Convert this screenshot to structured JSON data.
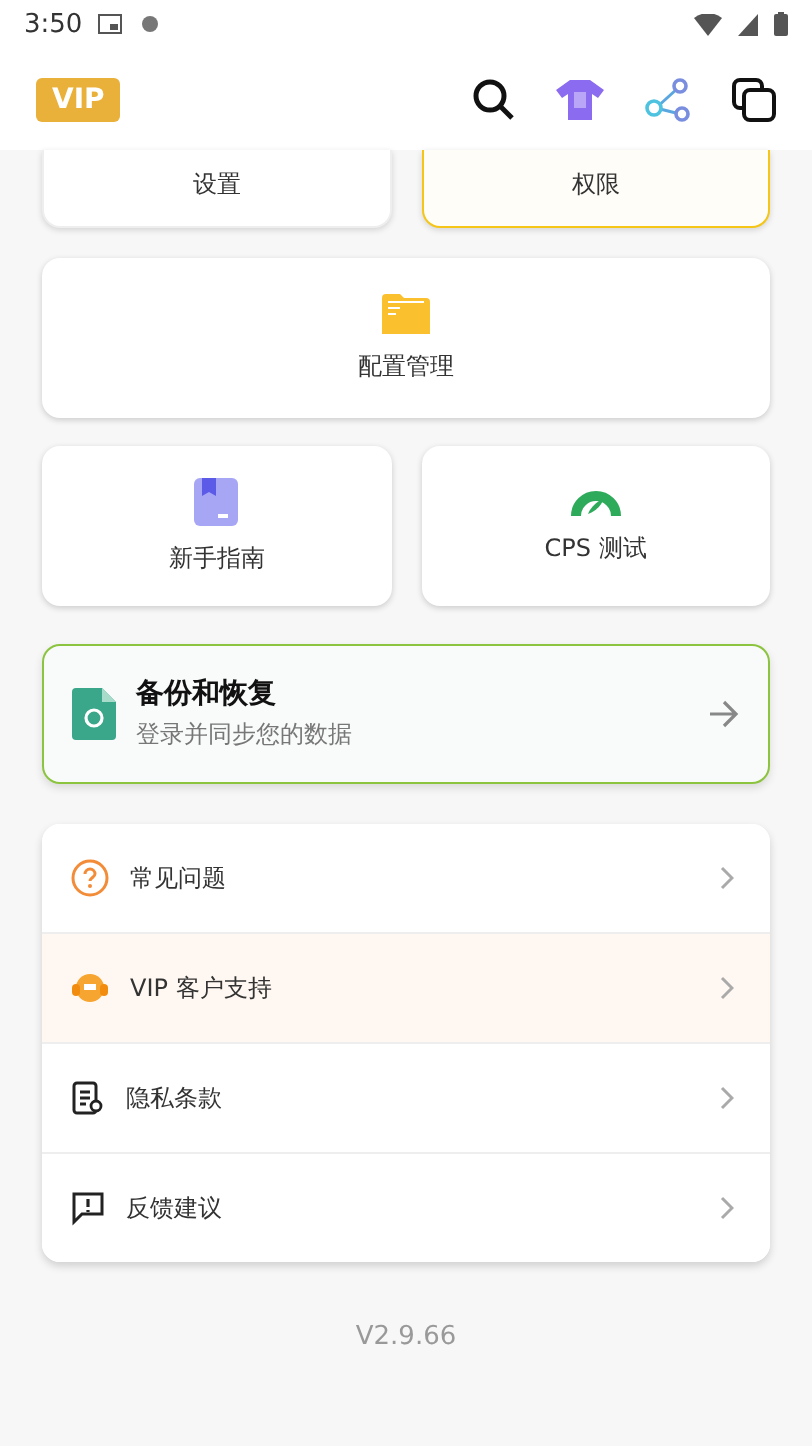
{
  "status_bar": {
    "time": "3:50"
  },
  "header": {
    "badge": "VIP"
  },
  "top_tiles": [
    {
      "label": "设置",
      "highlighted": false
    },
    {
      "label": "权限",
      "highlighted": true
    }
  ],
  "config_card": {
    "label": "配置管理"
  },
  "tiles": [
    {
      "label": "新手指南",
      "kind": "guide"
    },
    {
      "label": "CPS 测试",
      "kind": "gauge"
    }
  ],
  "backup": {
    "title": "备份和恢复",
    "subtitle": "登录并同步您的数据"
  },
  "menu": [
    {
      "label": "常见问题",
      "kind": "help",
      "highlighted": false
    },
    {
      "label": "VIP 客户支持",
      "kind": "support",
      "highlighted": true
    },
    {
      "label": "隐私条款",
      "kind": "privacy",
      "highlighted": false
    },
    {
      "label": "反馈建议",
      "kind": "feedback",
      "highlighted": false
    }
  ],
  "version": "V2.9.66"
}
